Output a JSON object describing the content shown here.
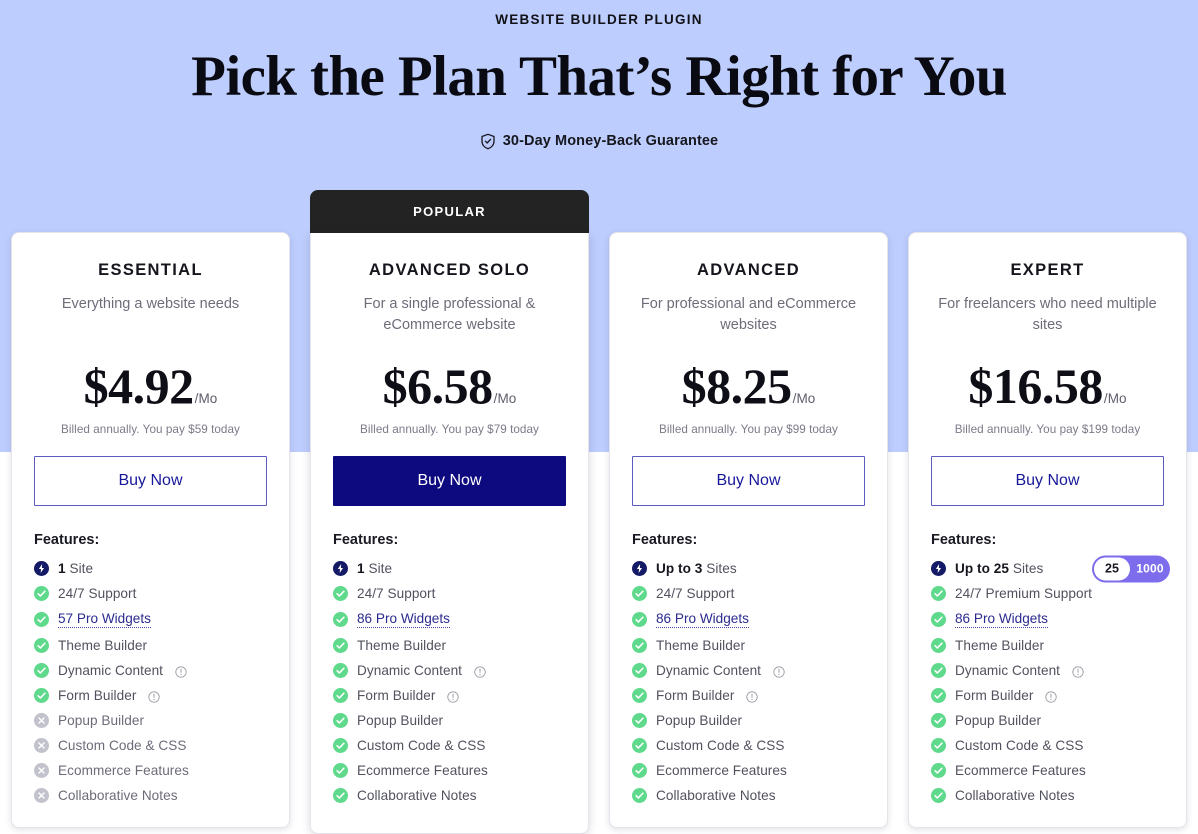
{
  "header": {
    "eyebrow": "WEBSITE BUILDER PLUGIN",
    "headline": "Pick the Plan That’s Right for You",
    "guarantee": "30-Day Money-Back Guarantee",
    "guarantee_icon": "shield-check-icon"
  },
  "colors": {
    "background": "#bdcdfd",
    "primary_button": "#0d0a80",
    "outline_button_border": "#5b5bc0",
    "popular_banner": "#232323",
    "check_green": "#5fd98b",
    "cross_gray": "#c2c2cc",
    "bolt_navy": "#141a66",
    "slider_purple": "#7d6cec",
    "link": "#2b2b8f"
  },
  "popular_badge": "POPULAR",
  "features_label": "Features:",
  "buy_label": "Buy Now",
  "per_month": "/Mo",
  "plans": [
    {
      "name": "ESSENTIAL",
      "desc": "Everything a website needs",
      "price": "$4.92",
      "per": "/Mo",
      "billed": "Billed annually. You pay $59 today",
      "buy_label": "Buy Now",
      "popular": false,
      "features": [
        {
          "icon": "bolt-icon",
          "strong": "1",
          "text": "Site"
        },
        {
          "icon": "check-icon",
          "text": "24/7 Support"
        },
        {
          "icon": "check-icon",
          "link": "57 Pro Widgets"
        },
        {
          "icon": "check-icon",
          "text": "Theme Builder"
        },
        {
          "icon": "check-icon",
          "text": "Dynamic Content",
          "info": true
        },
        {
          "icon": "check-icon",
          "text": "Form Builder",
          "info": true
        },
        {
          "icon": "cross-icon",
          "text": "Popup Builder"
        },
        {
          "icon": "cross-icon",
          "text": "Custom Code & CSS"
        },
        {
          "icon": "cross-icon",
          "text": "Ecommerce Features"
        },
        {
          "icon": "cross-icon",
          "text": "Collaborative Notes"
        }
      ]
    },
    {
      "name": "ADVANCED SOLO",
      "desc": "For a single professional & eCommerce website",
      "price": "$6.58",
      "per": "/Mo",
      "billed": "Billed annually. You pay $79 today",
      "buy_label": "Buy Now",
      "popular": true,
      "features": [
        {
          "icon": "bolt-icon",
          "strong": "1",
          "text": "Site"
        },
        {
          "icon": "check-icon",
          "text": "24/7 Support"
        },
        {
          "icon": "check-icon",
          "link": "86 Pro Widgets"
        },
        {
          "icon": "check-icon",
          "text": "Theme Builder"
        },
        {
          "icon": "check-icon",
          "text": "Dynamic Content",
          "info": true
        },
        {
          "icon": "check-icon",
          "text": "Form Builder",
          "info": true
        },
        {
          "icon": "check-icon",
          "text": "Popup Builder"
        },
        {
          "icon": "check-icon",
          "text": "Custom Code & CSS"
        },
        {
          "icon": "check-icon",
          "text": "Ecommerce Features"
        },
        {
          "icon": "check-icon",
          "text": "Collaborative Notes"
        }
      ]
    },
    {
      "name": "ADVANCED",
      "desc": "For professional and eCommerce websites",
      "price": "$8.25",
      "per": "/Mo",
      "billed": "Billed annually. You pay $99 today",
      "buy_label": "Buy Now",
      "popular": false,
      "features": [
        {
          "icon": "bolt-icon",
          "strong": "Up to 3",
          "text": "Sites"
        },
        {
          "icon": "check-icon",
          "text": "24/7 Support"
        },
        {
          "icon": "check-icon",
          "link": "86 Pro Widgets"
        },
        {
          "icon": "check-icon",
          "text": "Theme Builder"
        },
        {
          "icon": "check-icon",
          "text": "Dynamic Content",
          "info": true
        },
        {
          "icon": "check-icon",
          "text": "Form Builder",
          "info": true
        },
        {
          "icon": "check-icon",
          "text": "Popup Builder"
        },
        {
          "icon": "check-icon",
          "text": "Custom Code & CSS"
        },
        {
          "icon": "check-icon",
          "text": "Ecommerce Features"
        },
        {
          "icon": "check-icon",
          "text": "Collaborative Notes"
        }
      ]
    },
    {
      "name": "EXPERT",
      "desc": "For freelancers who need multiple sites",
      "price": "$16.58",
      "per": "/Mo",
      "billed": "Billed annually. You pay $199 today",
      "buy_label": "Buy Now",
      "popular": false,
      "slider": {
        "value": "25",
        "max": "1000"
      },
      "features": [
        {
          "icon": "bolt-icon",
          "strong": "Up to 25",
          "text": "Sites",
          "slider": true
        },
        {
          "icon": "check-icon",
          "text": "24/7 Premium Support"
        },
        {
          "icon": "check-icon",
          "link": "86 Pro Widgets"
        },
        {
          "icon": "check-icon",
          "text": "Theme Builder"
        },
        {
          "icon": "check-icon",
          "text": "Dynamic Content",
          "info": true
        },
        {
          "icon": "check-icon",
          "text": "Form Builder",
          "info": true
        },
        {
          "icon": "check-icon",
          "text": "Popup Builder"
        },
        {
          "icon": "check-icon",
          "text": "Custom Code & CSS"
        },
        {
          "icon": "check-icon",
          "text": "Ecommerce Features"
        },
        {
          "icon": "check-icon",
          "text": "Collaborative Notes"
        }
      ]
    }
  ]
}
